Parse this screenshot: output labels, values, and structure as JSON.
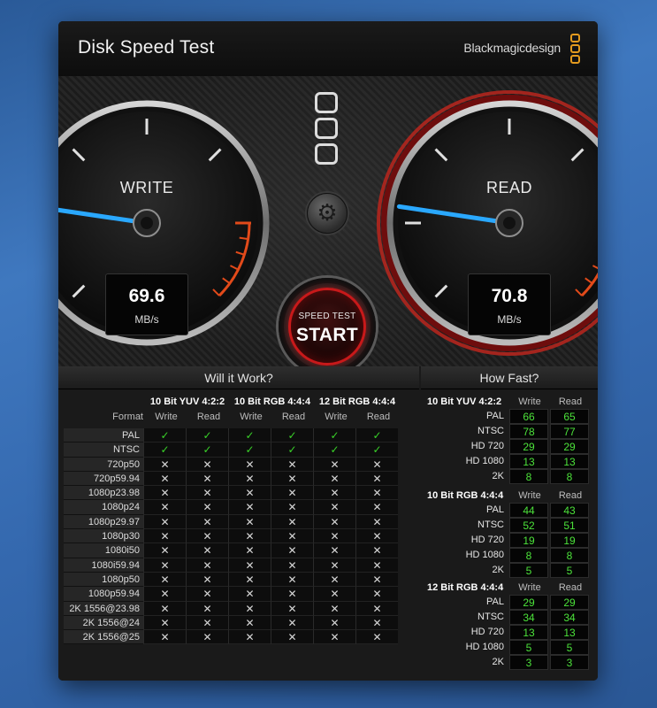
{
  "window": {
    "title": "Disk Speed Test",
    "brand": "Blackmagicdesign",
    "close_icon": "×"
  },
  "write_gauge": {
    "label": "WRITE",
    "value": "69.6",
    "unit": "MB/s",
    "needle_value": 69.6
  },
  "read_gauge": {
    "label": "READ",
    "value": "70.8",
    "unit": "MB/s",
    "needle_value": 70.8
  },
  "start_button": {
    "line1": "SPEED TEST",
    "line2": "START"
  },
  "will_it_work": {
    "title": "Will it Work?",
    "format_header": "Format",
    "groups": [
      "10 Bit YUV 4:2:2",
      "10 Bit RGB 4:4:4",
      "12 Bit RGB 4:4:4"
    ],
    "write_label": "Write",
    "read_label": "Read",
    "ok_glyph": "✓",
    "no_glyph": "✕",
    "rows": [
      {
        "format": "PAL",
        "ok": true
      },
      {
        "format": "NTSC",
        "ok": true
      },
      {
        "format": "720p50",
        "ok": false
      },
      {
        "format": "720p59.94",
        "ok": false
      },
      {
        "format": "1080p23.98",
        "ok": false
      },
      {
        "format": "1080p24",
        "ok": false
      },
      {
        "format": "1080p29.97",
        "ok": false
      },
      {
        "format": "1080p30",
        "ok": false
      },
      {
        "format": "1080i50",
        "ok": false
      },
      {
        "format": "1080i59.94",
        "ok": false
      },
      {
        "format": "1080p50",
        "ok": false
      },
      {
        "format": "1080p59.94",
        "ok": false
      },
      {
        "format": "2K 1556@23.98",
        "ok": false
      },
      {
        "format": "2K 1556@24",
        "ok": false
      },
      {
        "format": "2K 1556@25",
        "ok": false
      }
    ]
  },
  "how_fast": {
    "title": "How Fast?",
    "write_label": "Write",
    "read_label": "Read",
    "groups": [
      {
        "name": "10 Bit YUV 4:2:2",
        "rows": [
          {
            "format": "PAL",
            "write": "66",
            "read": "65"
          },
          {
            "format": "NTSC",
            "write": "78",
            "read": "77"
          },
          {
            "format": "HD 720",
            "write": "29",
            "read": "29"
          },
          {
            "format": "HD 1080",
            "write": "13",
            "read": "13"
          },
          {
            "format": "2K",
            "write": "8",
            "read": "8"
          }
        ]
      },
      {
        "name": "10 Bit RGB 4:4:4",
        "rows": [
          {
            "format": "PAL",
            "write": "44",
            "read": "43"
          },
          {
            "format": "NTSC",
            "write": "52",
            "read": "51"
          },
          {
            "format": "HD 720",
            "write": "19",
            "read": "19"
          },
          {
            "format": "HD 1080",
            "write": "8",
            "read": "8"
          },
          {
            "format": "2K",
            "write": "5",
            "read": "5"
          }
        ]
      },
      {
        "name": "12 Bit RGB 4:4:4",
        "rows": [
          {
            "format": "PAL",
            "write": "29",
            "read": "29"
          },
          {
            "format": "NTSC",
            "write": "34",
            "read": "34"
          },
          {
            "format": "HD 720",
            "write": "13",
            "read": "13"
          },
          {
            "format": "HD 1080",
            "write": "5",
            "read": "5"
          },
          {
            "format": "2K",
            "write": "3",
            "read": "3"
          }
        ]
      }
    ]
  },
  "colors": {
    "accent": "#e39a1e",
    "ok": "#39d129",
    "value": "#4ce23a",
    "start_ring": "#c8191a",
    "needle": "#2aa8ff"
  }
}
